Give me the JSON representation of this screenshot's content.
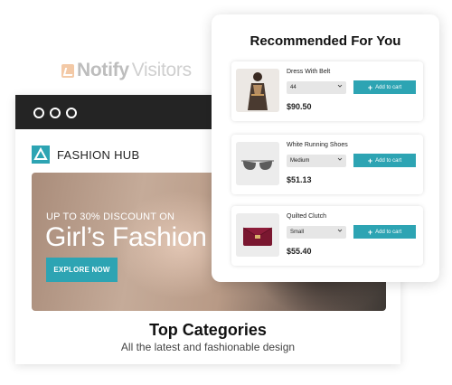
{
  "brand_logo": {
    "part1": "Notify",
    "part2": "Visitors"
  },
  "site": {
    "name": "FASHION HUB",
    "hero_subtitle": "UP TO 30% DISCOUNT ON",
    "hero_title": "Girl’s Fashion",
    "hero_button": "EXPLORE NOW",
    "section_title": "Top Categories",
    "section_subtitle": "All the latest and fashionable design"
  },
  "recommendations": {
    "title": "Recommended For You",
    "items": [
      {
        "name": "Dress With Belt",
        "option": "44",
        "price": "$90.50",
        "button": "Add to cart"
      },
      {
        "name": "White Running Shoes",
        "option": "Medium",
        "price": "$51.13",
        "button": "Add to cart"
      },
      {
        "name": "Quilted Clutch",
        "option": "Small",
        "price": "$55.40",
        "button": "Add to cart"
      }
    ]
  },
  "colors": {
    "accent": "#2da4b3",
    "topbar": "#242424"
  }
}
